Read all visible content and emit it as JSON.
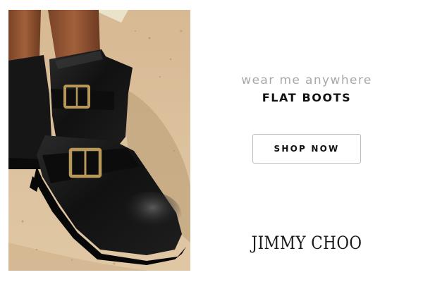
{
  "ad": {
    "tagline": "wear me anywhere",
    "headline": "FLAT BOOTS",
    "cta_label": "SHOP NOW",
    "brand": "JIMMY CHOO"
  },
  "colors": {
    "tagline": "#a8a8a8",
    "headline": "#111111",
    "button_border": "#bdbdbd",
    "sand": "#d9bd97",
    "leather": "#141414",
    "buckle": "#b8985a"
  },
  "image": {
    "subject": "black-leather-ankle-boots-on-sand"
  }
}
